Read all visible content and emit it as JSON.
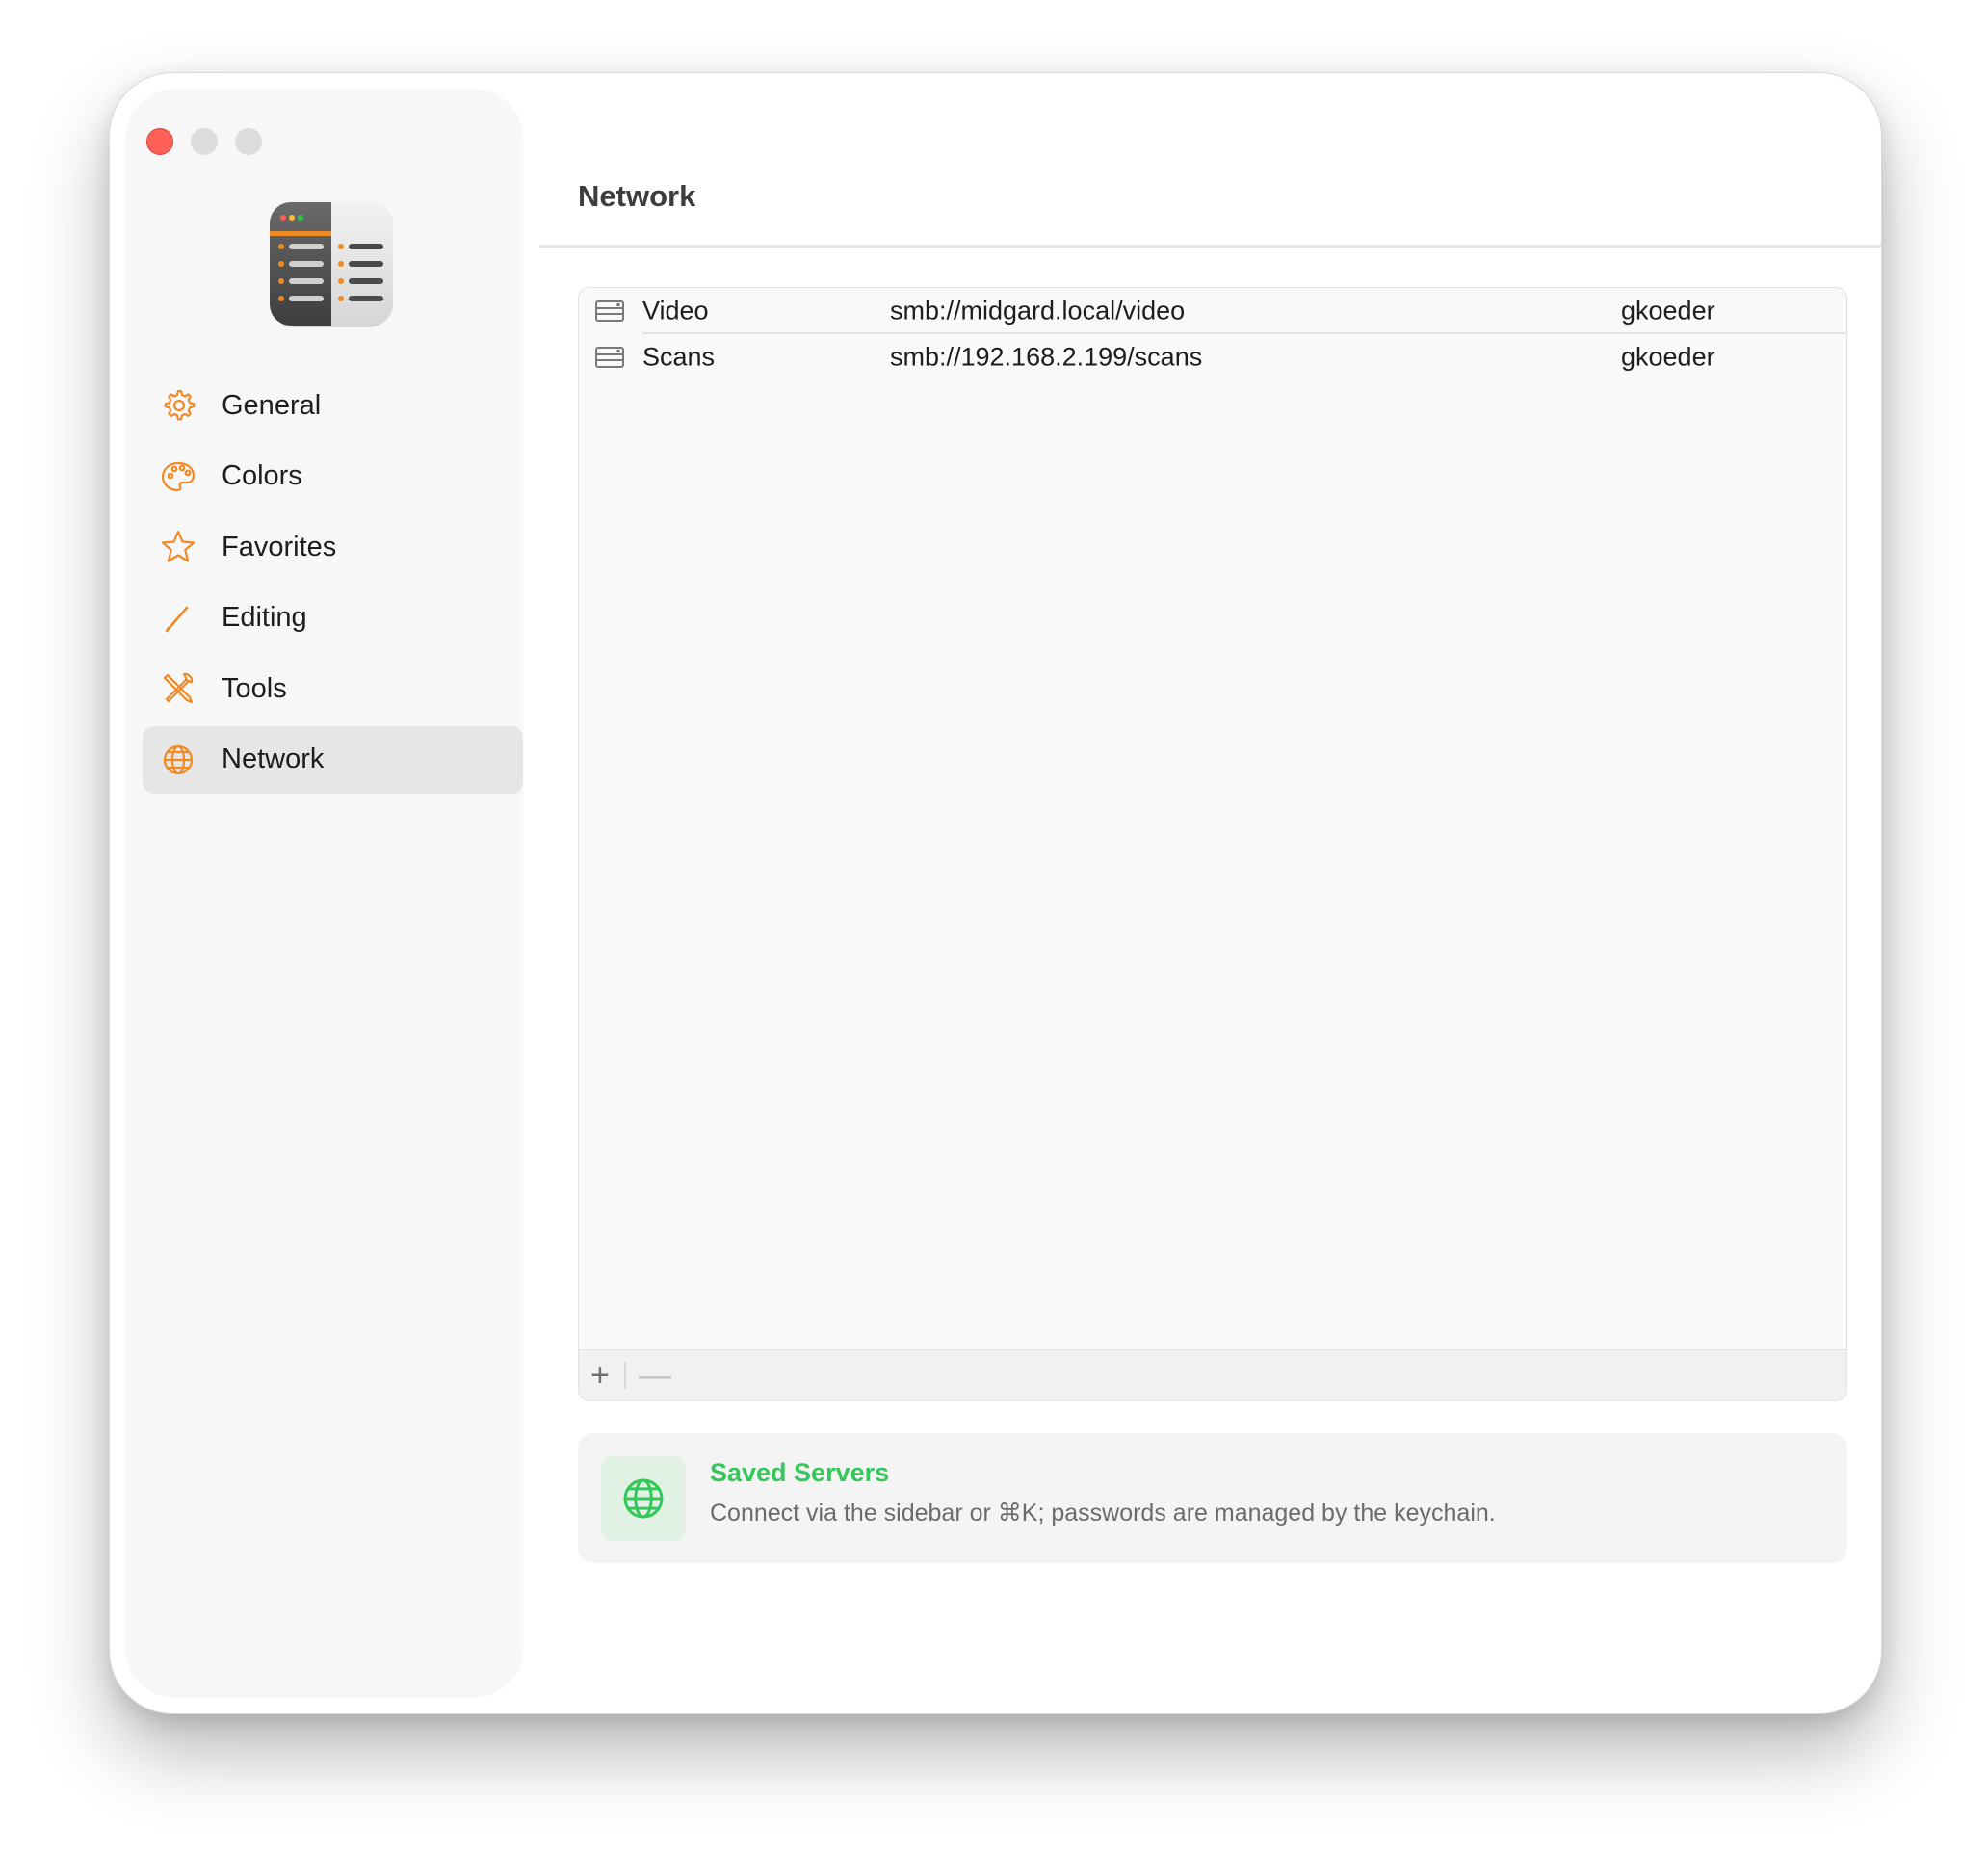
{
  "window": {
    "page_title": "Network"
  },
  "sidebar": {
    "items": [
      {
        "label": "General",
        "icon": "gear-icon"
      },
      {
        "label": "Colors",
        "icon": "palette-icon"
      },
      {
        "label": "Favorites",
        "icon": "star-icon"
      },
      {
        "label": "Editing",
        "icon": "pencil-icon"
      },
      {
        "label": "Tools",
        "icon": "tools-icon"
      },
      {
        "label": "Network",
        "icon": "globe-icon",
        "selected": true
      }
    ]
  },
  "servers": {
    "rows": [
      {
        "name": "Video",
        "url": "smb://midgard.local/video",
        "user": "gkoeder"
      },
      {
        "name": "Scans",
        "url": "smb://192.168.2.199/scans",
        "user": "gkoeder"
      }
    ],
    "add_label": "+",
    "remove_label": "—"
  },
  "info": {
    "title": "Saved Servers",
    "text": "Connect via the sidebar or ⌘K; passwords are managed by the keychain."
  },
  "colors": {
    "accent_orange": "#f08a24",
    "accent_green": "#34c759",
    "close_red": "#fe5f57"
  }
}
